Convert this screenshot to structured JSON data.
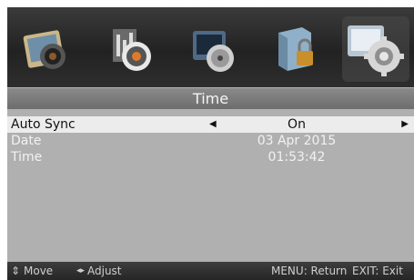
{
  "menu": {
    "icons": [
      {
        "name": "picture-icon",
        "selected": false
      },
      {
        "name": "sound-icon",
        "selected": false
      },
      {
        "name": "channel-icon",
        "selected": false
      },
      {
        "name": "lock-icon",
        "selected": false
      },
      {
        "name": "setup-icon",
        "selected": true
      }
    ],
    "title": "Time",
    "items": [
      {
        "label": "Auto Sync",
        "value": "On",
        "selected": true
      },
      {
        "label": "Date",
        "value": "03 Apr 2015",
        "selected": false
      },
      {
        "label": "Time",
        "value": "01:53:42",
        "selected": false
      }
    ]
  },
  "footer": {
    "move_label": "Move",
    "adjust_label": "Adjust",
    "menu_hint": "MENU: Return",
    "exit_hint": "EXIT: Exit"
  },
  "colors": {
    "content_bg": "#b0b0b0",
    "highlight_bg": "#ececec",
    "title_bg": "#7a7a7a"
  }
}
